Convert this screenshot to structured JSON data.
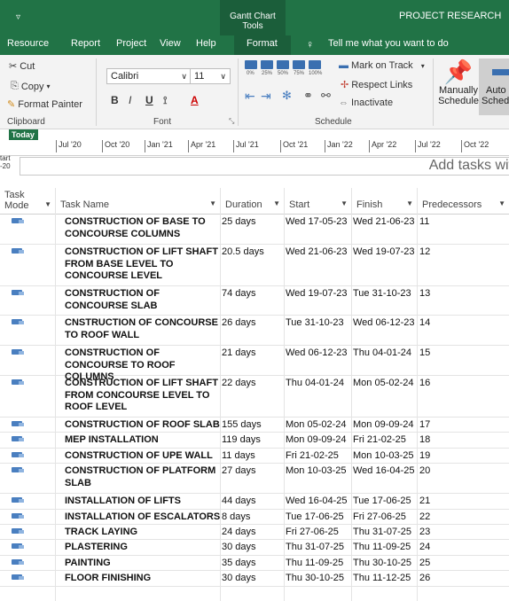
{
  "window": {
    "contextual_tab_group": "Gantt Chart Tools",
    "title": "PROJECT RESEARCH"
  },
  "tabs": [
    "Resource",
    "Report",
    "Project",
    "View",
    "Help",
    "Format"
  ],
  "tell_me": "Tell me what you want to do",
  "ribbon": {
    "cut": "Cut",
    "copy": "Copy",
    "format_painter": "Format Painter",
    "clipboard_label": "Clipboard",
    "font_name": "Calibri",
    "font_size": "11",
    "bold": "B",
    "italic": "I",
    "underline": "U",
    "font_color_glyph": "A",
    "font_label": "Font",
    "zoom_labels": [
      "0%",
      "25%",
      "50%",
      "75%",
      "100%"
    ],
    "mark_on_track": "Mark on Track",
    "respect_links": "Respect Links",
    "inactivate": "Inactivate",
    "schedule_label": "Schedule",
    "manually_line1": "Manually",
    "manually_line2": "Schedule",
    "auto_line1": "Auto",
    "auto_line2": "Sched"
  },
  "timeline": {
    "today": "Today",
    "ticks": [
      "Jul '20",
      "Oct '20",
      "Jan '21",
      "Apr '21",
      "Jul '21",
      "Oct '21",
      "Jan '22",
      "Apr '22",
      "Jul '22",
      "Oct '22"
    ],
    "start_line1": "tart",
    "start_line2": "-20",
    "placeholder": "Add tasks wit"
  },
  "columns": {
    "mode_line1": "Task",
    "mode_line2": "Mode",
    "name": "Task Name",
    "duration": "Duration",
    "start": "Start",
    "finish": "Finish",
    "predecessors": "Predecessors"
  },
  "tasks": [
    {
      "name": "CONSTRUCTION OF BASE TO CONCOURSE COLUMNS",
      "duration": "25 days",
      "start": "Wed 17-05-23",
      "finish": "Wed 21-06-23",
      "pred": "11"
    },
    {
      "name": "CONSTRUCTION OF LIFT SHAFT FROM BASE LEVEL TO CONCOURSE LEVEL",
      "duration": "20.5 days",
      "start": "Wed 21-06-23",
      "finish": "Wed 19-07-23",
      "pred": "12"
    },
    {
      "name": "CONSTRUCTION OF CONCOURSE SLAB",
      "duration": "74 days",
      "start": "Wed 19-07-23",
      "finish": "Tue 31-10-23",
      "pred": "13"
    },
    {
      "name": "CNSTRUCTION OF CONCOURSE TO ROOF WALL",
      "duration": "26 days",
      "start": "Tue 31-10-23",
      "finish": "Wed 06-12-23",
      "pred": "14"
    },
    {
      "name": "CONSTRUCTION OF CONCOURSE TO ROOF COLUMNS",
      "duration": "21 days",
      "start": "Wed 06-12-23",
      "finish": "Thu 04-01-24",
      "pred": "15"
    },
    {
      "name": "CONSTRUCTION OF LIFT SHAFT FROM CONCOURSE LEVEL TO ROOF LEVEL",
      "duration": "22 days",
      "start": "Thu 04-01-24",
      "finish": "Mon 05-02-24",
      "pred": "16"
    },
    {
      "name": "CONSTRUCTION OF ROOF SLAB",
      "duration": "155 days",
      "start": "Mon 05-02-24",
      "finish": "Mon 09-09-24",
      "pred": "17"
    },
    {
      "name": "MEP INSTALLATION",
      "duration": "119 days",
      "start": "Mon 09-09-24",
      "finish": "Fri 21-02-25",
      "pred": "18"
    },
    {
      "name": "CONSTRUCTION OF UPE WALL",
      "duration": "11 days",
      "start": "Fri 21-02-25",
      "finish": "Mon 10-03-25",
      "pred": "19"
    },
    {
      "name": "CONSTRUCTION OF PLATFORM SLAB",
      "duration": "27 days",
      "start": "Mon 10-03-25",
      "finish": "Wed 16-04-25",
      "pred": "20"
    },
    {
      "name": "INSTALLATION OF LIFTS",
      "duration": "44 days",
      "start": "Wed 16-04-25",
      "finish": "Tue 17-06-25",
      "pred": "21"
    },
    {
      "name": "INSTALLATION OF ESCALATORS",
      "duration": "8 days",
      "start": "Tue 17-06-25",
      "finish": "Fri 27-06-25",
      "pred": "22"
    },
    {
      "name": "TRACK LAYING",
      "duration": "24 days",
      "start": "Fri 27-06-25",
      "finish": "Thu 31-07-25",
      "pred": "23"
    },
    {
      "name": "PLASTERING",
      "duration": "30 days",
      "start": "Thu 31-07-25",
      "finish": "Thu 11-09-25",
      "pred": "24"
    },
    {
      "name": "PAINTING",
      "duration": "35 days",
      "start": "Thu 11-09-25",
      "finish": "Thu 30-10-25",
      "pred": "25"
    },
    {
      "name": "FLOOR FINISHING",
      "duration": "30 days",
      "start": "Thu 30-10-25",
      "finish": "Thu 11-12-25",
      "pred": "26"
    }
  ]
}
